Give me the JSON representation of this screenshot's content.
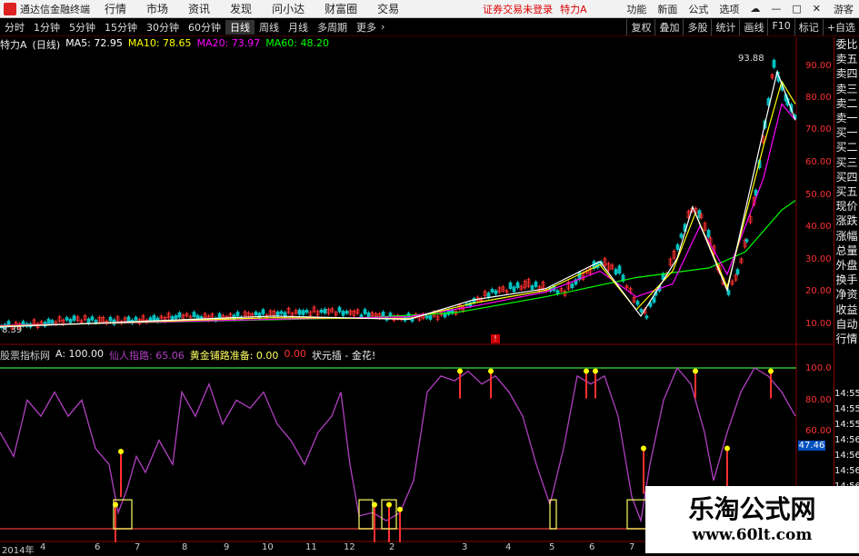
{
  "menubar": {
    "app_title": "通达信金融终端",
    "menus": [
      "行情",
      "市场",
      "资讯",
      "发现",
      "问小达",
      "财富圈",
      "交易"
    ],
    "login_status": "证券交易未登录",
    "stock_short": "特力A",
    "right_menus": [
      "功能",
      "新面",
      "公式",
      "选项"
    ],
    "guest": "游客"
  },
  "toolbar": {
    "periods": [
      "分时",
      "1分钟",
      "5分钟",
      "15分钟",
      "30分钟",
      "60分钟",
      "日线",
      "周线",
      "月线",
      "多周期",
      "更多"
    ],
    "active_period": "日线",
    "tools": [
      "复权",
      "叠加",
      "多股",
      "统计",
      "画线",
      "F10",
      "标记",
      "+自选"
    ]
  },
  "info": {
    "stock": "特力A",
    "period_tag": "(日线)",
    "ma5_label": "MA5: 72.95",
    "ma10_label": "MA10: 78.65",
    "ma20_label": "MA20: 73.97",
    "ma60_label": "MA60: 48.20"
  },
  "price_axis": {
    "ticks": [
      "90.00",
      "80.00",
      "70.00",
      "60.00",
      "50.00",
      "40.00",
      "30.00",
      "20.00",
      "10.00"
    ],
    "high_label": "93.88",
    "low_label": "8.39"
  },
  "sidebar": {
    "items": [
      "委比",
      "卖五",
      "卖四",
      "卖三",
      "卖二",
      "卖一",
      "买一",
      "买二",
      "买三",
      "买四",
      "买五",
      "现价",
      "涨跌",
      "涨幅",
      "总量",
      "外盘",
      "换手",
      "净资",
      "收益",
      "自动",
      "行情"
    ]
  },
  "indicator": {
    "name": "股票指标网",
    "a_label": "A: 100.00",
    "fairy_label": "仙人指路: 65.06",
    "gold_label": "黄金铺路准备: 0.00",
    "zero_label": "0.00",
    "champion_label": "状元插 - 金花!",
    "axis_ticks": [
      "100.0",
      "80.00",
      "60.00"
    ],
    "current_value": "47.46",
    "time_ticks": [
      "14:55",
      "14:55",
      "14:55",
      "14:56",
      "14:56",
      "14:56",
      "14:56"
    ]
  },
  "timeline": {
    "labels": [
      "2014年",
      "4",
      "6",
      "7",
      "8",
      "9",
      "10",
      "11",
      "12",
      "2",
      "3",
      "4",
      "5",
      "6",
      "7"
    ]
  },
  "watermark": {
    "title": "乐淘公式网",
    "url": "www.60lt.com"
  },
  "colors": {
    "ma5": "#ffffff",
    "ma10": "#ffff00",
    "ma20": "#ff00ff",
    "ma60": "#00ff00",
    "indicator_line": "#b040c0",
    "up": "#ff3030",
    "down": "#00c0c0"
  }
}
